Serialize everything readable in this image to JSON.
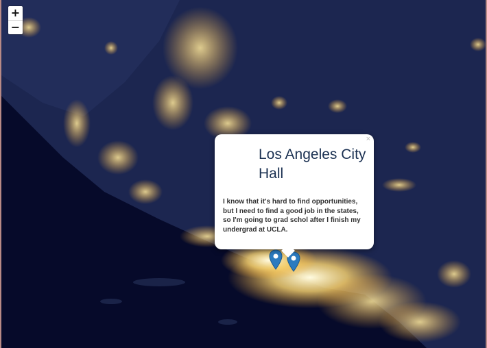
{
  "zoom_controls": {
    "zoom_in_label": "+",
    "zoom_out_label": "−"
  },
  "popup": {
    "close_label": "×",
    "title": "Los Angeles City Hall",
    "body": "I know that it's hard to find opportunities, but I need to find a good job in the states, so I'm going to grad schol after I finish my undergrad at UCLA."
  },
  "markers": [
    {
      "name": "marker-1",
      "color": "#2b7bbf"
    },
    {
      "name": "marker-2",
      "color": "#2b7bbf"
    }
  ],
  "colors": {
    "ocean": "#060a2a",
    "land": "#1c2650",
    "city_lights": "#fff0b0"
  }
}
